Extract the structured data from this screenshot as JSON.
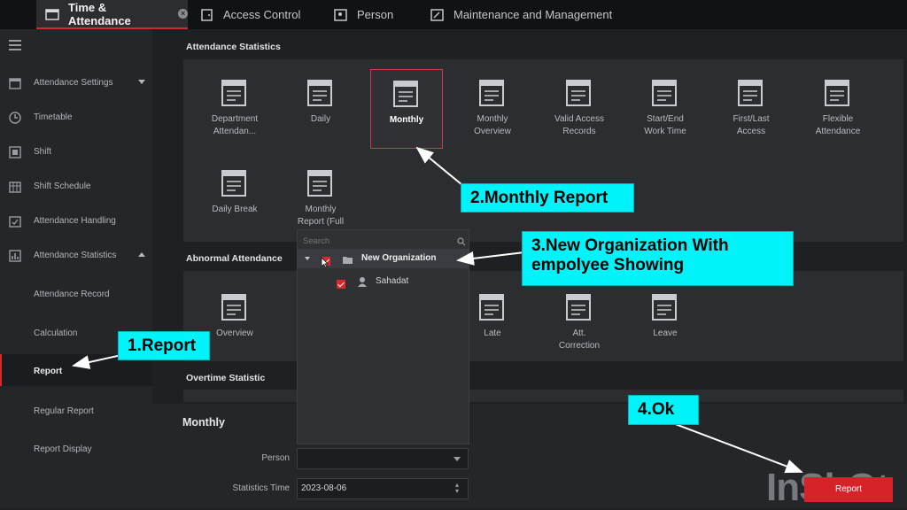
{
  "top_tabs": [
    {
      "label": "Time & Attendance",
      "icon": "calendar-icon",
      "active": true
    },
    {
      "label": "Access Control",
      "icon": "door-icon"
    },
    {
      "label": "Person",
      "icon": "person-card-icon"
    },
    {
      "label": "Maintenance and Management",
      "icon": "wrench-icon"
    }
  ],
  "sidebar": {
    "items": [
      {
        "label": "Attendance Settings",
        "icon": "settings-calendar-icon"
      },
      {
        "label": "Timetable",
        "icon": "clock-icon"
      },
      {
        "label": "Shift",
        "icon": "shift-icon"
      },
      {
        "label": "Shift Schedule",
        "icon": "schedule-icon"
      },
      {
        "label": "Attendance Handling",
        "icon": "handling-icon"
      },
      {
        "label": "Attendance Statistics",
        "icon": "statistics-icon"
      }
    ],
    "subitems": [
      "Attendance Record",
      "Calculation",
      "Report",
      "Regular Report",
      "Report Display"
    ]
  },
  "main": {
    "attendance_statistics_title": "Attendance Statistics",
    "abnormal_title": "Abnormal Attendance",
    "overtime_title": "Overtime Statistic",
    "stat_tiles": [
      {
        "line1": "Department",
        "line2": "Attendan..."
      },
      {
        "line1": "Daily",
        "line2": ""
      },
      {
        "line1": "Monthly",
        "line2": ""
      },
      {
        "line1": "Monthly",
        "line2": "Overview"
      },
      {
        "line1": "Valid Access",
        "line2": "Records"
      },
      {
        "line1": "Start/End",
        "line2": "Work Time"
      },
      {
        "line1": "First/Last",
        "line2": "Access"
      },
      {
        "line1": "Flexible",
        "line2": "Attendance"
      },
      {
        "line1": "Daily Break",
        "line2": ""
      },
      {
        "line1": "Monthly",
        "line2": "Report (Full"
      }
    ],
    "abnormal_tiles": [
      {
        "line1": "Overview",
        "line2": ""
      },
      {
        "line1": "Late",
        "line2": ""
      },
      {
        "line1": "Att.",
        "line2": "Correction"
      },
      {
        "line1": "Leave",
        "line2": ""
      }
    ]
  },
  "dropdown": {
    "search_placeholder": "Search",
    "org": "New Organization",
    "person": "Sahadat"
  },
  "form": {
    "title": "Monthly",
    "person_label": "Person",
    "person_value": "",
    "stats_time_label": "Statistics Time",
    "stats_time_value": "2023-08-06",
    "report_button": "Report"
  },
  "watermark": "InShOt",
  "annotations": {
    "a1": "1.Report",
    "a2": "2.Monthly Report",
    "a3_line1": "3.New Organization With",
    "a3_line2": "empolyee Showing",
    "a4": "4.Ok"
  },
  "colors": {
    "accent": "#d62a2a",
    "callout": "#00f3f8"
  }
}
